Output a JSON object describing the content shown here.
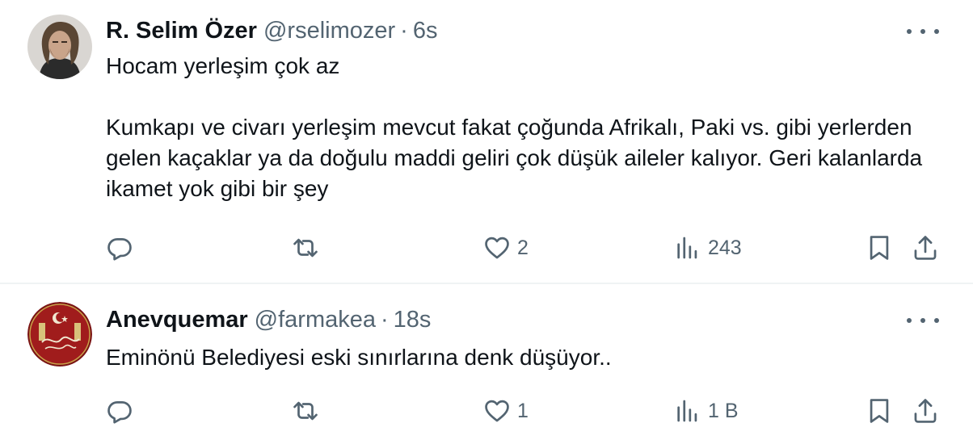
{
  "tweets": [
    {
      "name": "R. Selim Özer",
      "handle": "@rselimozer",
      "separator": "·",
      "time": "6s",
      "text": "Hocam yerleşim çok az\n\nKumkapı ve civarı yerleşim mevcut fakat çoğunda Afrikalı, Paki vs. gibi yerlerden gelen kaçaklar ya da doğulu maddi geliri çok düşük aileler kalıyor. Geri kalanlarda ikamet yok gibi bir şey",
      "likes": "2",
      "views": "243"
    },
    {
      "name": "Anevquemar",
      "handle": "@farmakea",
      "separator": "·",
      "time": "18s",
      "text": "Eminönü Belediyesi eski sınırlarına denk düşüyor..",
      "likes": "1",
      "views": "1 B"
    }
  ],
  "icons": {
    "reply": "reply-icon",
    "retweet": "retweet-icon",
    "like": "heart-icon",
    "views": "views-icon",
    "bookmark": "bookmark-icon",
    "share": "share-icon",
    "more": "more-icon"
  },
  "colors": {
    "text": "#0f1419",
    "secondary": "#536471",
    "divider": "#eff3f4"
  }
}
